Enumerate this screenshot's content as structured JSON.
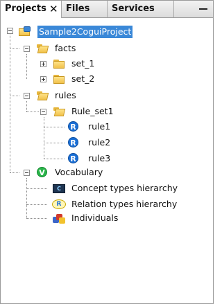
{
  "tabs": [
    {
      "label": "Projects",
      "active": true
    },
    {
      "label": "Files",
      "active": false
    },
    {
      "label": "Services",
      "active": false
    }
  ],
  "tab_close_glyph": "✕",
  "tree": {
    "project": "Sample2CoguiProject",
    "facts": "facts",
    "set_1": "set_1",
    "set_2": "set_2",
    "rules": "rules",
    "rule_set1": "Rule_set1",
    "rule1": "rule1",
    "rule2": "rule2",
    "rule3": "rule3",
    "vocabulary": "Vocabulary",
    "concept_types": "Concept types hierarchy",
    "relation_types": "Relation types hierarchy",
    "individuals": "Individuals"
  },
  "icons": {
    "rule": "R",
    "vocabulary": "V",
    "concept": "C",
    "relation": "R"
  },
  "colors": {
    "selection": "#3a88d8",
    "rule_icon": "#1a6fd6",
    "vocabulary_icon": "#29b54a"
  }
}
